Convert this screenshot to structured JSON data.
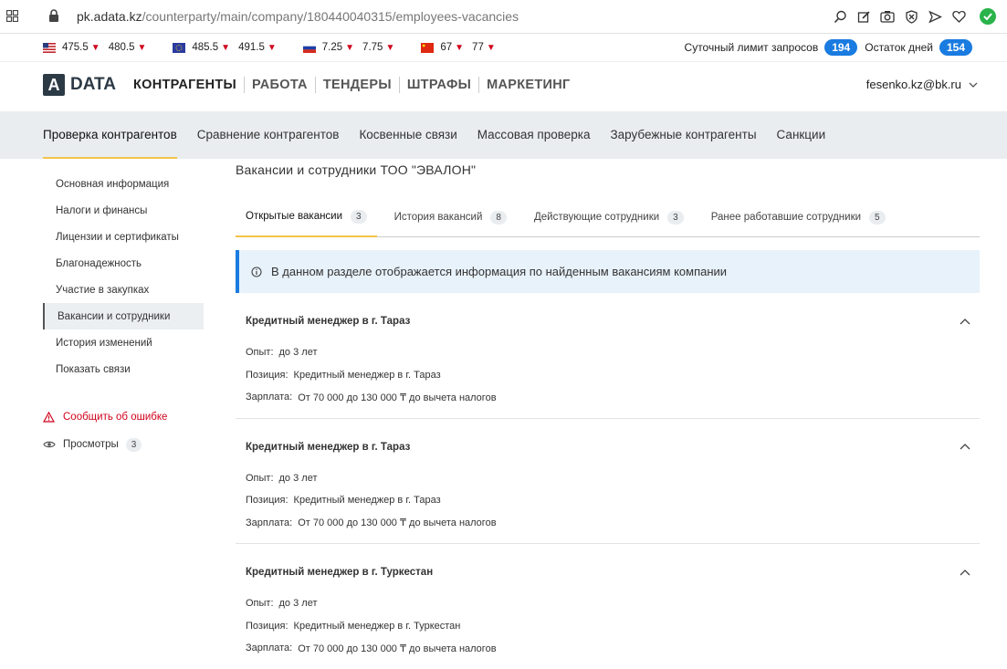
{
  "browser": {
    "url_host": "pk.adata.kz",
    "url_path": "/counterparty/main/company/180440040315/employees-vacancies"
  },
  "rates": [
    {
      "flag": "us",
      "buy": "475.5",
      "sell": "480.5"
    },
    {
      "flag": "eu",
      "buy": "485.5",
      "sell": "491.5"
    },
    {
      "flag": "ru",
      "buy": "7.25",
      "sell": "7.75"
    },
    {
      "flag": "cn",
      "buy": "67",
      "sell": "77"
    }
  ],
  "rate_down_symbol": "▼",
  "limits": {
    "daily_label": "Суточный лимит запросов",
    "daily_value": "194",
    "days_label": "Остаток дней",
    "days_value": "154"
  },
  "logo": {
    "mark": "A",
    "text": "DATA"
  },
  "topnav": [
    "КОНТРАГЕНТЫ",
    "РАБОТА",
    "ТЕНДЕРЫ",
    "ШТРАФЫ",
    "МАРКЕТИНГ"
  ],
  "user_email": "fesenko.kz@bk.ru",
  "subnav": [
    "Проверка контрагентов",
    "Сравнение контрагентов",
    "Косвенные связи",
    "Массовая проверка",
    "Зарубежные контрагенты",
    "Санкции"
  ],
  "sidebar": {
    "items": [
      "Основная информация",
      "Налоги и финансы",
      "Лицензии и сертификаты",
      "Благонадежность",
      "Участие в закупках",
      "Вакансии и сотрудники",
      "История изменений",
      "Показать связи"
    ],
    "report_label": "Сообщить об ошибке",
    "views_label": "Просмотры",
    "views_count": "3"
  },
  "page_title": "Вакансии и сотрудники ТОО \"ЭВАЛОН\"",
  "content_tabs": [
    {
      "label": "Открытые вакансии",
      "count": "3"
    },
    {
      "label": "История вакансий",
      "count": "8"
    },
    {
      "label": "Действующие сотрудники",
      "count": "3"
    },
    {
      "label": "Ранее работавшие сотрудники",
      "count": "5"
    }
  ],
  "info_text": "В данном разделе отображается информация по найденным вакансиям компании",
  "labels": {
    "experience": "Опыт:",
    "position": "Позиция:",
    "salary": "Зарплата:"
  },
  "vacancies": [
    {
      "title": "Кредитный менеджер в г. Тараз",
      "experience": "до 3 лет",
      "position": "Кредитный менеджер в г. Тараз",
      "salary": "От 70 000 до 130 000 ₸ до вычета налогов"
    },
    {
      "title": "Кредитный менеджер в г. Тараз",
      "experience": "до 3 лет",
      "position": "Кредитный менеджер в г. Тараз",
      "salary": "От 70 000 до 130 000 ₸ до вычета налогов"
    },
    {
      "title": "Кредитный менеджер в г. Туркестан",
      "experience": "до 3 лет",
      "position": "Кредитный менеджер в г. Туркестан",
      "salary": "От 70 000 до 130 000 ₸ до вычета налогов"
    }
  ]
}
